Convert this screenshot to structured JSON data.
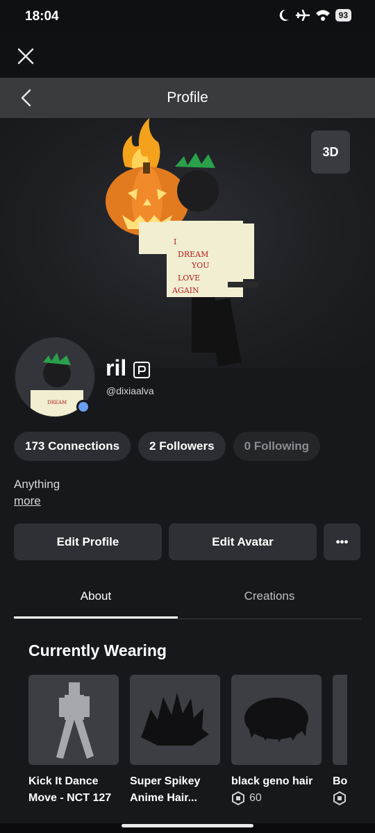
{
  "status_bar": {
    "time": "18:04",
    "battery": "93",
    "icons": [
      "moon-icon",
      "airplane-icon",
      "wifi-icon",
      "battery-icon"
    ]
  },
  "header": {
    "title": "Profile"
  },
  "hero": {
    "view_3d_label": "3D"
  },
  "profile": {
    "display_name": "ril",
    "username": "@dixiaalva",
    "bio": "Anything",
    "more_label": "more"
  },
  "stats": {
    "connections": "173 Connections",
    "followers": "2 Followers",
    "following": "0 Following"
  },
  "actions": {
    "edit_profile": "Edit Profile",
    "edit_avatar": "Edit Avatar",
    "more": "•••"
  },
  "tabs": [
    {
      "label": "About",
      "active": true
    },
    {
      "label": "Creations",
      "active": false
    }
  ],
  "wearing": {
    "title": "Currently Wearing",
    "items": [
      {
        "name_line1": "Kick It Dance",
        "name_line2": "Move - NCT 127",
        "price": ""
      },
      {
        "name_line1": "Super Spikey",
        "name_line2": "Anime Hair...",
        "price": ""
      },
      {
        "name_line1": "black geno hair",
        "name_line2": "",
        "price": "60"
      },
      {
        "name_line1": "Bo",
        "name_line2": "",
        "price": ""
      }
    ]
  },
  "colors": {
    "background": "#17181c",
    "header_bg": "#3a3b3f",
    "pill_bg": "#2d2e33",
    "online": "#6a9ef0"
  }
}
